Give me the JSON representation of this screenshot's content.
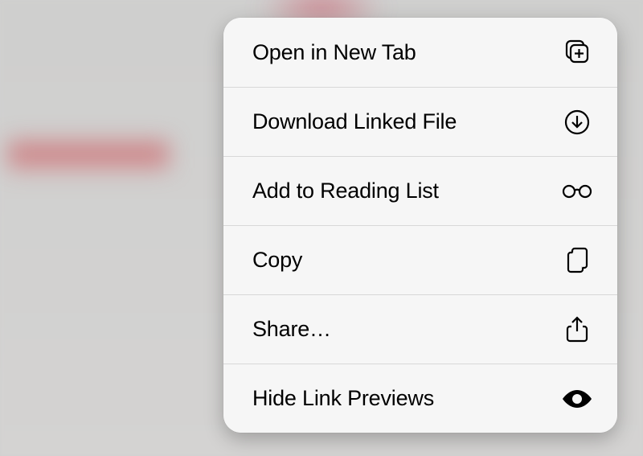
{
  "menu": {
    "items": [
      {
        "label": "Open in New Tab",
        "icon": "new-tab"
      },
      {
        "label": "Download Linked File",
        "icon": "download"
      },
      {
        "label": "Add to Reading List",
        "icon": "glasses"
      },
      {
        "label": "Copy",
        "icon": "copy"
      },
      {
        "label": "Share…",
        "icon": "share"
      },
      {
        "label": "Hide Link Previews",
        "icon": "eye"
      }
    ]
  }
}
